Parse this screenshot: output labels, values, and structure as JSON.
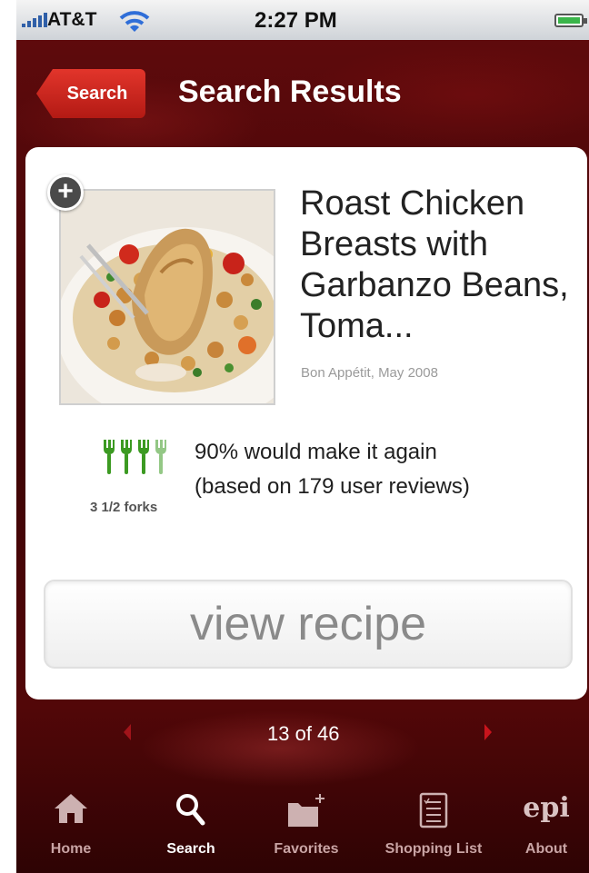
{
  "status_bar": {
    "carrier": "AT&T",
    "time": "2:27 PM"
  },
  "nav": {
    "back_label": "Search",
    "title": "Search Results"
  },
  "recipe": {
    "title": "Roast Chicken Breasts with Garbanzo Beans, Toma...",
    "source": "Bon Appétit, May 2008",
    "rating_label": "3 1/2 forks",
    "rating_value": 3.5,
    "rating_max": 4,
    "make_again": "90% would make it again",
    "reviews": "(based on 179 user reviews)",
    "view_button": "view recipe"
  },
  "pager": {
    "text": "13 of 46"
  },
  "tabbar": {
    "items": [
      {
        "label": "Home",
        "icon": "home-icon"
      },
      {
        "label": "Search",
        "icon": "search-icon",
        "active": true
      },
      {
        "label": "Favorites",
        "icon": "favorites-folder-icon"
      },
      {
        "label": "Shopping List",
        "icon": "shopping-list-icon"
      },
      {
        "label": "About",
        "icon": "epi-logo"
      }
    ],
    "logo_text": "epi"
  },
  "colors": {
    "accent": "#c8211a",
    "background": "#4a0608",
    "fork_green": "#3c9a22"
  }
}
